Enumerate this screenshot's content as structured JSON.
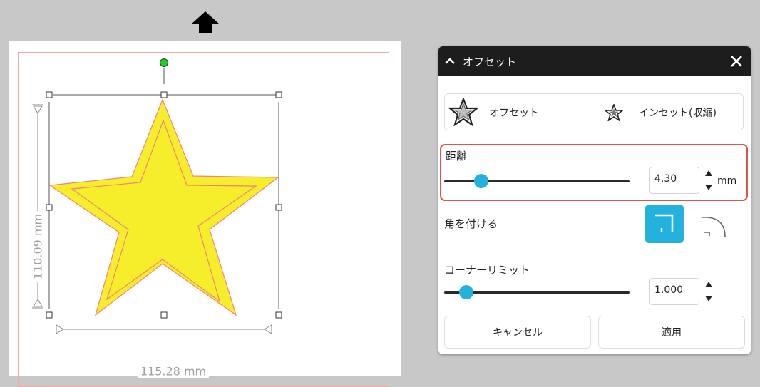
{
  "canvas": {
    "height_dimension": "110.09 mm",
    "width_dimension": "115.28 mm",
    "star_fill": "#f7ee2b",
    "cut_line_color": "#f08080",
    "rotate_handle_color": "#1fd11f"
  },
  "panel": {
    "title": "オフセット",
    "modes": {
      "offset_label": "オフセット",
      "inset_label": "インセット(収縮)"
    },
    "distance": {
      "label": "距離",
      "value": "4.30",
      "unit": "mm",
      "slider_fraction": 0.2
    },
    "corner": {
      "label": "角を付ける"
    },
    "corner_limit": {
      "label": "コーナーリミット",
      "value": "1.000",
      "slider_fraction": 0.12
    },
    "buttons": {
      "cancel": "キャンセル",
      "apply": "適用"
    },
    "accent_color": "#23b2dd",
    "highlight_color": "#d9574a"
  }
}
